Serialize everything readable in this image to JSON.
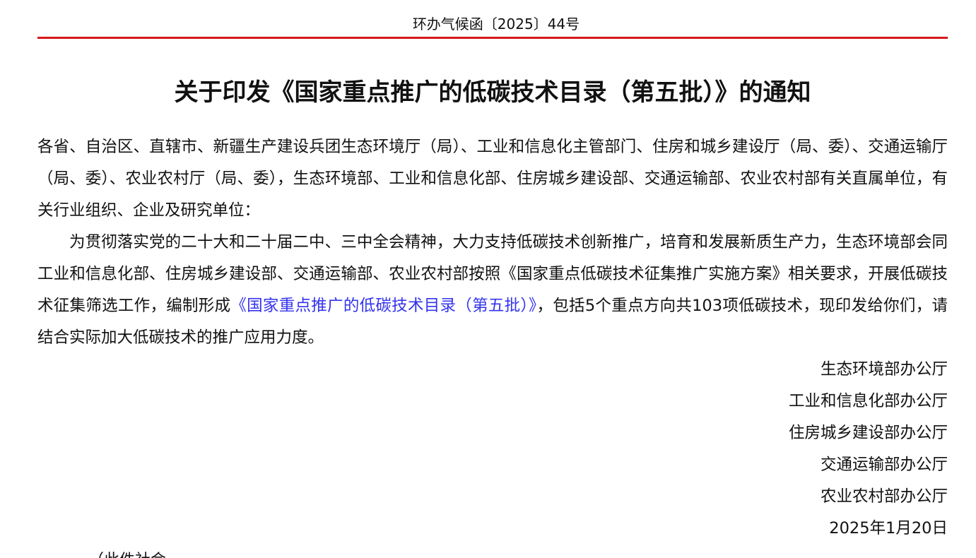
{
  "header": {
    "doc_number": "环办气候函〔2025〕44号"
  },
  "title": "关于印发《国家重点推广的低碳技术目录（第五批）》的通知",
  "addressees": "各省、自治区、直辖市、新疆生产建设兵团生态环境厅（局）、工业和信息化主管部门、住房和城乡建设厅（局、委）、交通运输厅（局、委）、农业农村厅（局、委），生态环境部、工业和信息化部、住房城乡建设部、交通运输部、农业农村部有关直属单位，有关行业组织、企业及研究单位：",
  "body": {
    "part1": "为贯彻落实党的二十大和二十届二中、三中全会精神，大力支持低碳技术创新推广，培育和发展新质生产力，生态环境部会同工业和信息化部、住房城乡建设部、交通运输部、农业农村部按照《国家重点低碳技术征集推广实施方案》相关要求，开展低碳技术征集筛选工作，编制形成",
    "link_text": "《国家重点推广的低碳技术目录（第五批）》",
    "part2": "，包括5个重点方向共103项低碳技术，现印发给你们，请结合实际加大低碳技术的推广应用力度。"
  },
  "signatures": [
    "生态环境部办公厅",
    "工业和信息化部办公厅",
    "住房城乡建设部办公厅",
    "交通运输部办公厅",
    "农业农村部办公厅"
  ],
  "date": "2025年1月20日",
  "footer_cutoff": "（此件社会"
}
